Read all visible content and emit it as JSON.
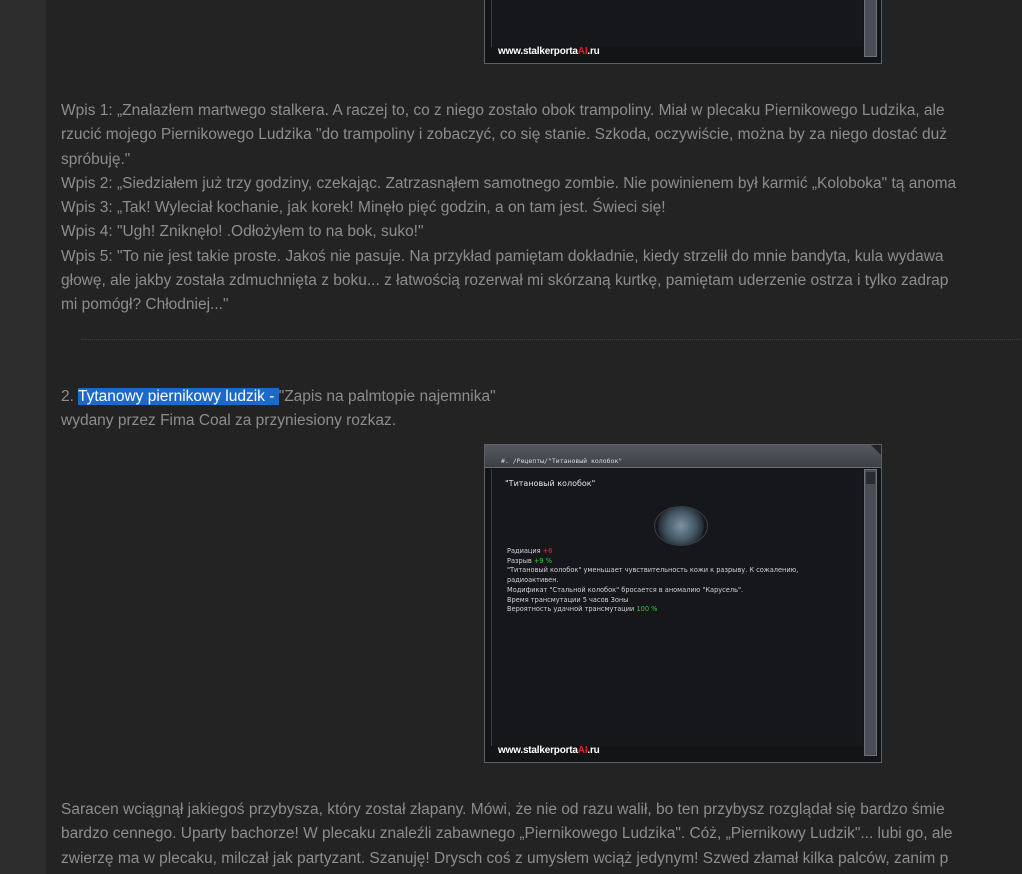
{
  "screenshot_top": {
    "watermark_prefix": "www.stalkerporta",
    "watermark_accent": "AI",
    "watermark_suffix": ".ru"
  },
  "entries": [
    "Wpis 1: „Znalazłem martwego stalkera. A raczej to, co z niego zostało obok trampoliny. Miał w plecaku Piernikowego Ludzika, ale",
    "rzucić mojego Piernikowego Ludzika \"do trampoliny i zobaczyć, co się stanie. Szkoda, oczywiście, można by za niego dostać duż",
    "spróbuję.\"",
    "Wpis 2: „Siedziałem już trzy godziny, czekając. Zatrzasnąłem samotnego zombie. Nie powinienem był karmić „Koloboka\" tą anoma",
    "Wpis 3: „Tak! Wyleciał kochanie, jak korek! Minęło pięć godzin, a on tam jest. Świeci się!",
    "Wpis 4: \"Ugh! Zniknęło! .Odłożyłem to na bok, suko!\"",
    "Wpis 5: \"To nie jest takie proste. Jakoś nie pasuje. Na przykład pamiętam dokładnie, kiedy strzelił do mnie bandyta, kula wydawa",
    "głowę, ale jakby została zdmuchnięta z boku... z łatwością rozerwał mi skórzaną kurtkę, pamiętam uderzenie ostrza i tylko zadrap",
    "mi pomógł? Chłodniej...\""
  ],
  "item2": {
    "number": "2. ",
    "title": "Tytanowy piernikowy ludzik",
    "dash": " - ",
    "subtitle": "\"Zapis na palmtopie najemnika\"",
    "description": "wydany przez Fima Coal za przyniesiony rozkaz."
  },
  "screenshot_main": {
    "path": "#. /Рецепты/\"Титановый колобок\"",
    "heading": "\"Титановый колобок\"",
    "radiation_label": "Радиация ",
    "radiation_value": "+6",
    "rupture_label": "Разрыв ",
    "rupture_value": "+9 %",
    "desc_line1": "\"Титановый колобок\" уменьшает чувствительность кожи к разрыву. К сожалению,",
    "desc_line2": "радиоактивен.",
    "modifier": "Модификат \"Стальной колобок\" бросается в аномалию \"Карусель\".",
    "time": "Время трансмутации 5 часов Зоны",
    "probability_label": "Вероятность удачной трансмутации ",
    "probability_value": "100 %",
    "watermark_prefix": "www.stalkerporta",
    "watermark_accent": "AI",
    "watermark_suffix": ".ru"
  },
  "story": [
    "Saracen wciągnął jakiegoś przybysza, który został złapany. Mówi, że nie od razu walił, bo ten przybysz rozglądał się bardzo śmie",
    "bardzo cennego. Uparty bachorze! W plecaku znaleźli zabawnego „Piernikowego Ludzika\". Cóż, „Piernikowy Ludzik\"... lubi go, ale",
    "zwierzę ma w plecaku, milczał jak partyzant. Szanuję! Drysch coś z umysłem wciąż jedynym! Szwed złamał kilka palców, zanim p"
  ],
  "colors": {
    "background": "#232323",
    "text": "#8d8d8d",
    "highlight": "#1c69c9"
  }
}
